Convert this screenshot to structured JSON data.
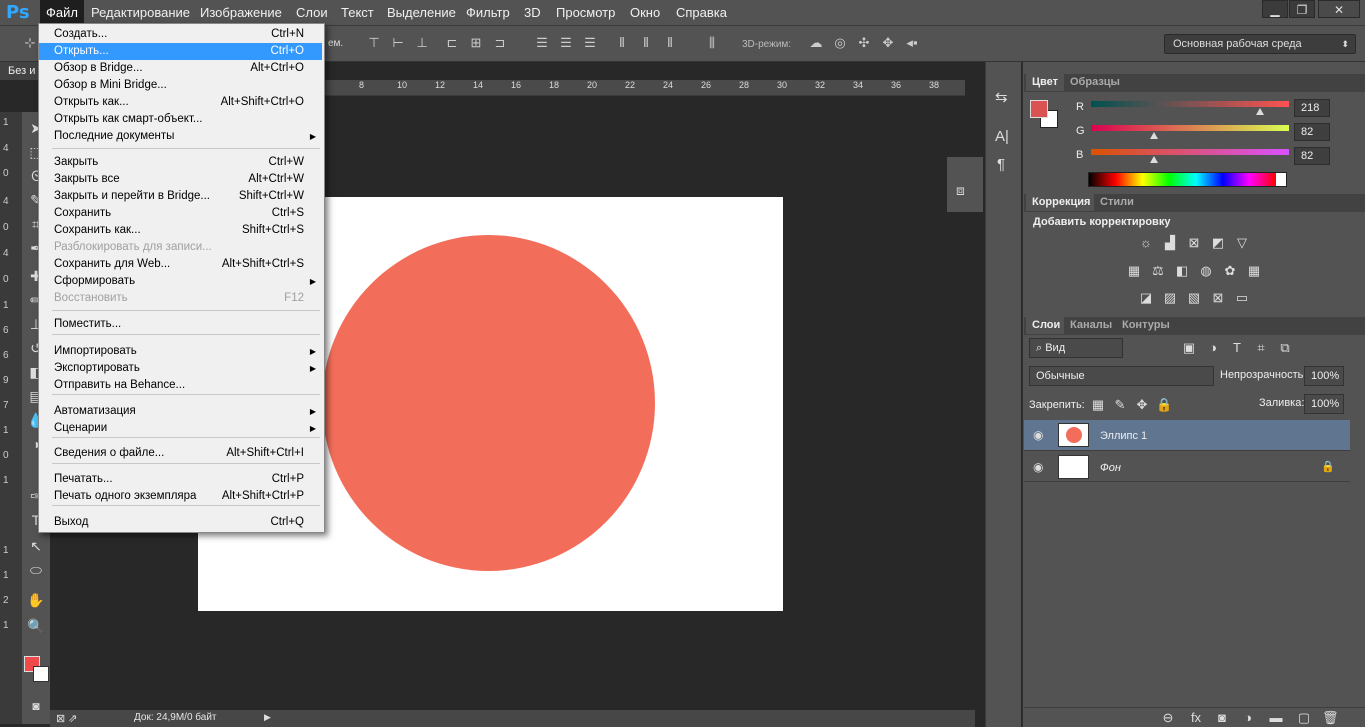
{
  "app": {
    "logo": "Ps"
  },
  "menubar": {
    "items": [
      "Файл",
      "Редактирование",
      "Изображение",
      "Слои",
      "Текст",
      "Выделение",
      "Фильтр",
      "3D",
      "Просмотр",
      "Окно",
      "Справка"
    ]
  },
  "window_controls": {
    "minimize": "▁",
    "restore": "❐",
    "close": "✕"
  },
  "options_bar": {
    "label_fragment": "ем.",
    "mode_3d": "3D-режим:",
    "workspace": "Основная рабочая среда"
  },
  "document": {
    "tab_title": "Без и",
    "zoom_strip": [
      "1",
      "4",
      "0",
      "4",
      "0",
      "4",
      "0",
      "1",
      "6",
      "6",
      "9",
      "7",
      "1",
      "0",
      "1",
      "1",
      "1",
      "2",
      "1"
    ]
  },
  "ruler": {
    "ticks": [
      "8",
      "10",
      "12",
      "14",
      "16",
      "18",
      "20",
      "22",
      "24",
      "26",
      "28",
      "30",
      "32",
      "34",
      "36",
      "38"
    ]
  },
  "canvas": {
    "ellipse_color": "#f36e5a",
    "background": "#ffffff"
  },
  "statusbar": {
    "doc_size": "Док: 24,9M/0 байт"
  },
  "file_menu": {
    "items": [
      {
        "label": "Создать...",
        "shortcut": "Ctrl+N"
      },
      {
        "label": "Открыть...",
        "shortcut": "Ctrl+O",
        "highlighted": true
      },
      {
        "label": "Обзор в Bridge...",
        "shortcut": "Alt+Ctrl+O"
      },
      {
        "label": "Обзор в Mini Bridge...",
        "shortcut": ""
      },
      {
        "label": "Открыть как...",
        "shortcut": "Alt+Shift+Ctrl+O"
      },
      {
        "label": "Открыть как смарт-объект...",
        "shortcut": ""
      },
      {
        "label": "Последние документы",
        "shortcut": "",
        "submenu": true
      },
      {
        "label": "Закрыть",
        "shortcut": "Ctrl+W"
      },
      {
        "label": "Закрыть все",
        "shortcut": "Alt+Ctrl+W"
      },
      {
        "label": "Закрыть и перейти в Bridge...",
        "shortcut": "Shift+Ctrl+W"
      },
      {
        "label": "Сохранить",
        "shortcut": "Ctrl+S"
      },
      {
        "label": "Сохранить как...",
        "shortcut": "Shift+Ctrl+S"
      },
      {
        "label": "Разблокировать для записи...",
        "shortcut": "",
        "disabled": true
      },
      {
        "label": "Сохранить для Web...",
        "shortcut": "Alt+Shift+Ctrl+S"
      },
      {
        "label": "Сформировать",
        "shortcut": "",
        "submenu": true
      },
      {
        "label": "Восстановить",
        "shortcut": "F12",
        "disabled": true
      },
      {
        "label": "Поместить...",
        "shortcut": ""
      },
      {
        "label": "Импортировать",
        "shortcut": "",
        "submenu": true
      },
      {
        "label": "Экспортировать",
        "shortcut": "",
        "submenu": true
      },
      {
        "label": "Отправить на Behance...",
        "shortcut": ""
      },
      {
        "label": "Автоматизация",
        "shortcut": "",
        "submenu": true
      },
      {
        "label": "Сценарии",
        "shortcut": "",
        "submenu": true
      },
      {
        "label": "Сведения о файле...",
        "shortcut": "Alt+Shift+Ctrl+I"
      },
      {
        "label": "Печатать...",
        "shortcut": "Ctrl+P"
      },
      {
        "label": "Печать одного экземпляра",
        "shortcut": "Alt+Shift+Ctrl+P"
      },
      {
        "label": "Выход",
        "shortcut": "Ctrl+Q"
      }
    ]
  },
  "color_panel": {
    "tabs": [
      "Цвет",
      "Образцы"
    ],
    "channels": [
      {
        "name": "R",
        "value": "218",
        "fraction": 0.855
      },
      {
        "name": "G",
        "value": "82",
        "fraction": 0.32
      },
      {
        "name": "B",
        "value": "82",
        "fraction": 0.32
      }
    ],
    "foreground": "#da5252",
    "background": "#ffffff"
  },
  "adjustments_panel": {
    "tabs": [
      "Коррекция",
      "Стили"
    ],
    "title": "Добавить корректировку"
  },
  "layers_panel": {
    "tabs": [
      "Слои",
      "Каналы",
      "Контуры"
    ],
    "filter": "Вид",
    "blend_mode": "Обычные",
    "opacity_label": "Непрозрачность:",
    "opacity": "100%",
    "lock_label": "Закрепить:",
    "fill_label": "Заливка:",
    "fill": "100%",
    "layers": [
      {
        "name": "Эллипс 1",
        "selected": true
      },
      {
        "name": "Фон",
        "selected": false
      }
    ]
  }
}
